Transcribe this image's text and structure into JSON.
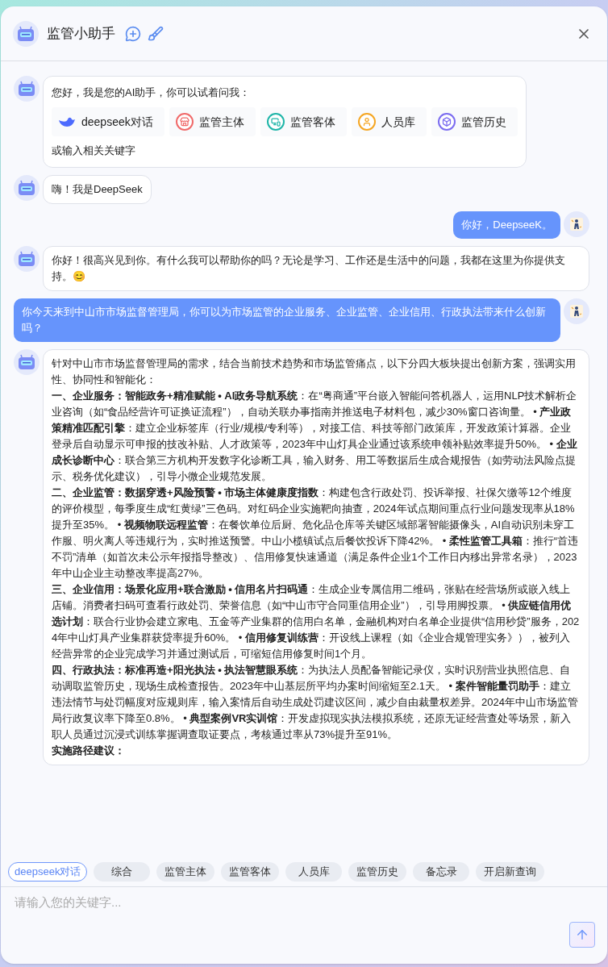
{
  "header": {
    "title": "监管小助手"
  },
  "messages": [
    {
      "kind": "welcome",
      "text": "您好，我是您的AI助手，你可以试着问我：",
      "shortcuts": [
        {
          "label": "deepseek对话",
          "kind": "whale",
          "color": "#4d6bfe"
        },
        {
          "label": "监管主体",
          "kind": "store",
          "color": "#f06a6a"
        },
        {
          "label": "监管客体",
          "kind": "screen",
          "color": "#1fb5a8"
        },
        {
          "label": "人员库",
          "kind": "person",
          "color": "#f5a623"
        },
        {
          "label": "监管历史",
          "kind": "cube",
          "color": "#7b6cf0"
        }
      ],
      "footer": "或输入相关关键字"
    },
    {
      "kind": "bot",
      "paragraphs": [
        "嗨！我是DeepSeek"
      ]
    },
    {
      "kind": "user",
      "paragraphs": [
        "你好，DeepseeK。"
      ]
    },
    {
      "kind": "bot",
      "paragraphs": [
        "你好！很高兴见到你。有什么我可以帮助你的吗？无论是学习、工作还是生活中的问题，我都在这里为你提供支持。😊"
      ]
    },
    {
      "kind": "user",
      "paragraphs": [
        "你今天来到中山市市场监督管理局，你可以为市场监管的企业服务、企业监管、企业信用、行政执法带来什么创新吗？"
      ]
    },
    {
      "kind": "bot",
      "paragraphs": [
        "针对中山市市场监督管理局的需求，结合当前技术趋势和市场监管痛点，以下分四大板块提出创新方案，强调实用性、协同性和智能化：",
        "**一、企业服务：智能政务+精准赋能 • AI政务导航系统**：在“粤商通”平台嵌入智能问答机器人，运用NLP技术解析企业咨询（如“食品经营许可证换证流程”），自动关联办事指南并推送电子材料包，减少30%窗口咨询量。 • **产业政策精准匹配引擎**：建立企业标签库（行业/规模/专利等），对接工信、科技等部门政策库，开发政策计算器。企业登录后自动显示可申报的技改补贴、人才政策等，2023年中山灯具企业通过该系统申领补贴效率提升50%。 • **企业成长诊断中心**：联合第三方机构开发数字化诊断工具，输入财务、用工等数据后生成合规报告（如劳动法风险点提示、税务优化建议），引导小微企业规范发展。",
        "**二、企业监管：数据穿透+风险预警 • 市场主体健康度指数**：构建包含行政处罚、投诉举报、社保欠缴等12个维度的评价模型，每季度生成“红黄绿”三色码。对红码企业实施靶向抽查，2024年试点期间重点行业问题发现率从18%提升至35%。 • **视频物联远程监管**：在餐饮单位后厨、危化品仓库等关键区域部署智能摄像头，AI自动识别未穿工作服、明火离人等违规行为，实时推送预警。中山小榄镇试点后餐饮投诉下降42%。 • **柔性监管工具箱**：推行“首违不罚”清单（如首次未公示年报指导整改）、信用修复快速通道（满足条件企业1个工作日内移出异常名录），2023年中山企业主动整改率提高27%。",
        "**三、企业信用：场景化应用+联合激励 • 信用名片扫码通**：生成企业专属信用二维码，张贴在经营场所或嵌入线上店铺。消费者扫码可查看行政处罚、荣誉信息（如“中山市守合同重信用企业”），引导用脚投票。 • **供应链信用优选计划**：联合行业协会建立家电、五金等产业集群的信用白名单，金融机构对白名单企业提供“信用秒贷”服务，2024年中山灯具产业集群获贷率提升60%。 • **信用修复训练营**：开设线上课程（如《企业合规管理实务》），被列入经营异常的企业完成学习并通过测试后，可缩短信用修复时间1个月。",
        "**四、行政执法：标准再造+阳光执法 • 执法智慧眼系统**：为执法人员配备智能记录仪，实时识别营业执照信息、自动调取监管历史，现场生成检查报告。2023年中山基层所平均办案时间缩短至2.1天。 • **案件智能量罚助手**：建立违法情节与处罚幅度对应规则库，输入案情后自动生成处罚建议区间，减少自由裁量权差异。2024年中山市场监管局行政复议率下降至0.8%。 • **典型案例VR实训馆**：开发虚拟现实执法模拟系统，还原无证经营查处等场景，新入职人员通过沉浸式训练掌握调查取证要点，考核通过率从73%提升至91%。",
        "**实施路径建议：**"
      ]
    }
  ],
  "quick_tabs": [
    {
      "label": "deepseek对话",
      "selected": true
    },
    {
      "label": "综合",
      "selected": false
    },
    {
      "label": "监管主体",
      "selected": false
    },
    {
      "label": "监管客体",
      "selected": false
    },
    {
      "label": "人员库",
      "selected": false
    },
    {
      "label": "监管历史",
      "selected": false
    },
    {
      "label": "备忘录",
      "selected": false
    },
    {
      "label": "开启新查询",
      "selected": false
    }
  ],
  "input": {
    "placeholder": "请输入您的关键字..."
  }
}
